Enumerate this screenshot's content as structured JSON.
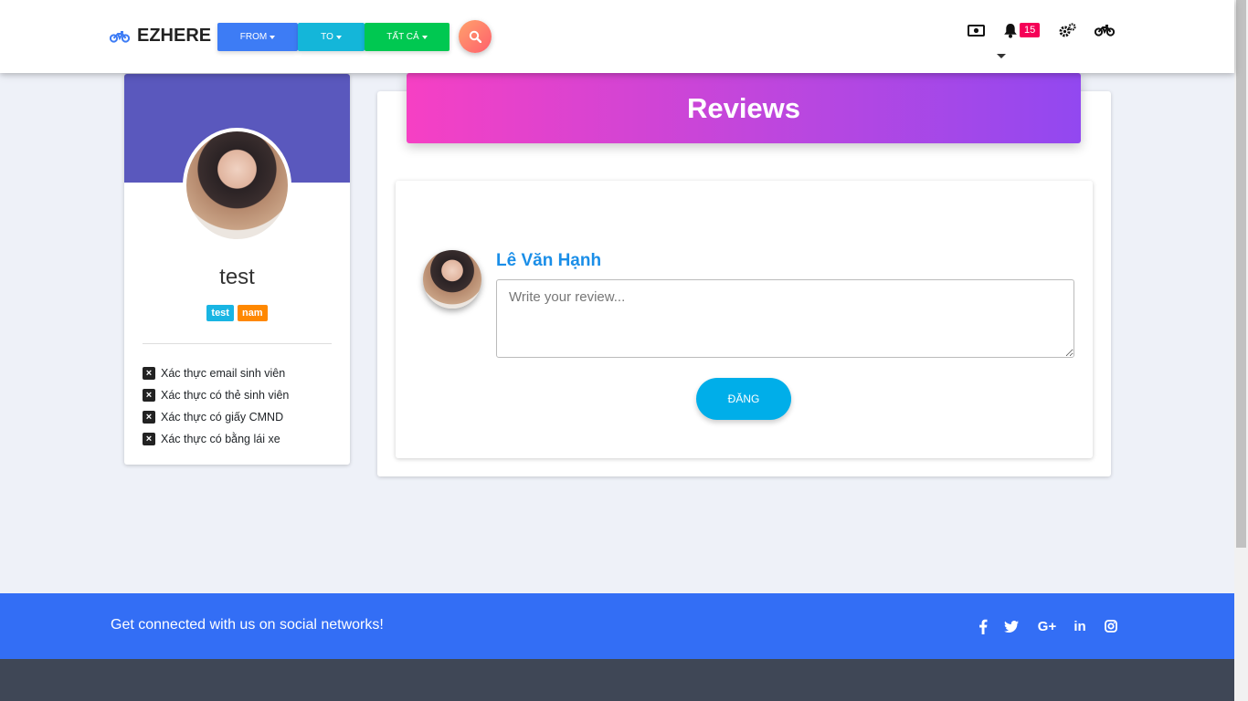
{
  "brand": {
    "name": "EZHERE",
    "icon": "motorcycle-icon",
    "color": "#3d7cf5"
  },
  "nav": {
    "from_label": "FROM",
    "to_label": "TO",
    "all_label": "TẤT CẢ",
    "search_icon": "search-icon",
    "notification_count": "15",
    "icons": [
      "money-icon",
      "bell-icon",
      "cogs-icon",
      "motorcycle-icon"
    ]
  },
  "profile": {
    "name": "test",
    "tags": [
      "test",
      "nam"
    ],
    "verifications": [
      "Xác thực email sinh viên",
      "Xác thực có thẻ sinh viên",
      "Xác thực có giấy CMND",
      "Xác thực có bằng lái xe"
    ]
  },
  "reviews": {
    "title": "Reviews",
    "reviewer_name": "Lê Văn Hạnh",
    "input_placeholder": "Write your review...",
    "input_value": "",
    "post_label": "ĐĂNG"
  },
  "footer": {
    "social_text": "Get connected with us on social networks!",
    "social_icons": [
      "facebook-icon",
      "twitter-icon",
      "google-plus-icon",
      "linkedin-icon",
      "instagram-icon"
    ]
  },
  "colors": {
    "accent_blue": "#336ef5",
    "header_gradient_start": "#f640c4",
    "header_gradient_end": "#9248f0",
    "profile_header": "#5a58bd",
    "post_button": "#00aee9"
  }
}
